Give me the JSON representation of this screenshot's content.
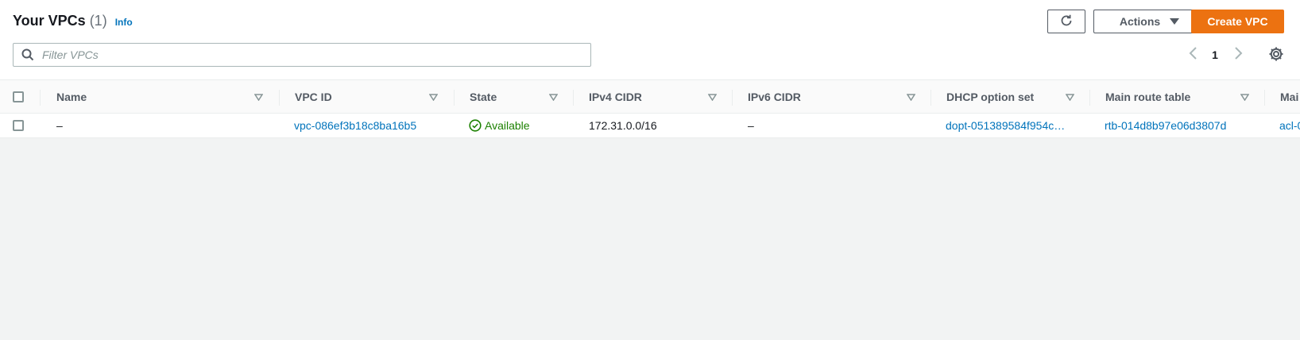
{
  "header": {
    "title": "Your VPCs",
    "count": "(1)",
    "info_label": "Info"
  },
  "toolbar": {
    "actions_label": "Actions",
    "create_label": "Create VPC"
  },
  "filter": {
    "placeholder": "Filter VPCs",
    "value": ""
  },
  "pagination": {
    "current_page": "1"
  },
  "table": {
    "columns": [
      "Name",
      "VPC ID",
      "State",
      "IPv4 CIDR",
      "IPv6 CIDR",
      "DHCP option set",
      "Main route table",
      "Mai"
    ],
    "rows": [
      {
        "name": "–",
        "vpc_id": "vpc-086ef3b18c8ba16b5",
        "state": "Available",
        "ipv4_cidr": "172.31.0.0/16",
        "ipv6_cidr": "–",
        "dhcp_option_set": "dopt-051389584f954c…",
        "main_route_table": "rtb-014d8b97e06d3807d",
        "main_network_acl": "acl-0"
      }
    ]
  },
  "colors": {
    "link": "#0073bb",
    "primary": "#ec7211",
    "success": "#1d8102"
  },
  "icons": [
    "refresh-icon",
    "caret-down-icon",
    "search-icon",
    "chevron-left-icon",
    "chevron-right-icon",
    "gear-icon",
    "sort-icon",
    "status-success-icon"
  ]
}
